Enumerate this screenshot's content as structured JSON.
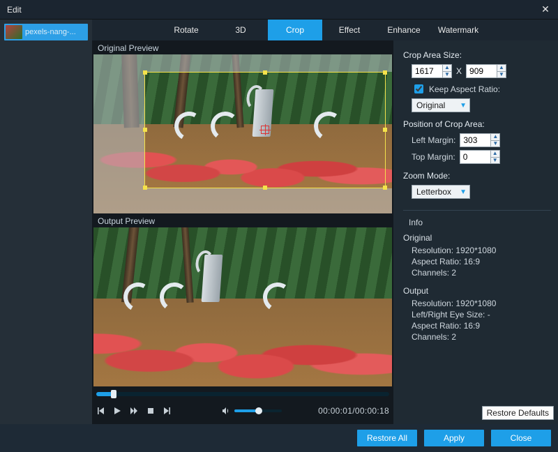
{
  "window": {
    "title": "Edit"
  },
  "sidebar": {
    "clip_name": "pexels-nang-..."
  },
  "tabs": {
    "items": [
      "Rotate",
      "3D",
      "Crop",
      "Effect",
      "Enhance",
      "Watermark"
    ],
    "active": "Crop"
  },
  "preview": {
    "original_label": "Original Preview",
    "output_label": "Output Preview"
  },
  "transport": {
    "current": "00:00:01",
    "total": "00:00:18",
    "separator": "/"
  },
  "panel": {
    "crop_area_size": {
      "title": "Crop Area Size:",
      "width": "1617",
      "height": "909",
      "x": "X",
      "keep_aspect_label": "Keep Aspect Ratio:",
      "keep_aspect_checked": true,
      "aspect_select": "Original"
    },
    "position": {
      "title": "Position of Crop Area:",
      "left_label": "Left Margin:",
      "left_value": "303",
      "top_label": "Top Margin:",
      "top_value": "0"
    },
    "zoom": {
      "title": "Zoom Mode:",
      "value": "Letterbox"
    },
    "info": {
      "header": "Info",
      "original": {
        "head": "Original",
        "resolution_label": "Resolution:",
        "resolution_value": "1920*1080",
        "aspect_label": "Aspect Ratio:",
        "aspect_value": "16:9",
        "channels_label": "Channels:",
        "channels_value": "2"
      },
      "output": {
        "head": "Output",
        "resolution_label": "Resolution:",
        "resolution_value": "1920*1080",
        "eye_label": "Left/Right Eye Size:",
        "eye_value": "-",
        "aspect_label": "Aspect Ratio:",
        "aspect_value": "16:9",
        "channels_label": "Channels:",
        "channels_value": "2"
      }
    },
    "restore_defaults": "Restore Defaults"
  },
  "footer": {
    "restore_all": "Restore All",
    "apply": "Apply",
    "close": "Close"
  }
}
